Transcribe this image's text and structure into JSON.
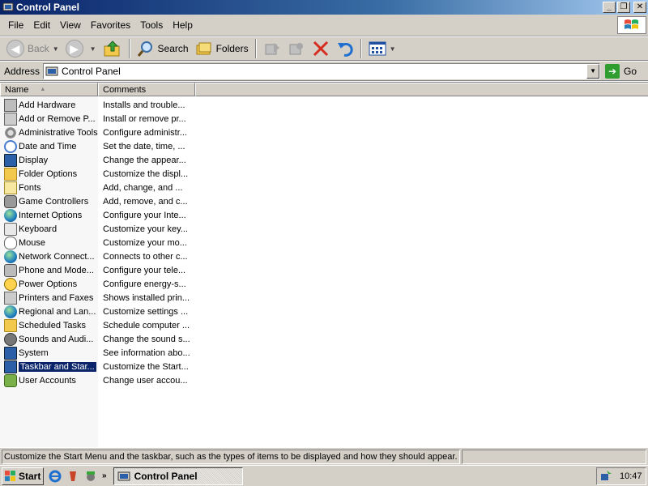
{
  "window": {
    "title": "Control Panel",
    "minimize": "_",
    "restore": "❐",
    "close": "✕"
  },
  "menu": [
    "File",
    "Edit",
    "View",
    "Favorites",
    "Tools",
    "Help"
  ],
  "toolbar": {
    "back": "Back",
    "search": "Search",
    "folders": "Folders"
  },
  "address": {
    "label": "Address",
    "value": "Control Panel",
    "go": "Go"
  },
  "columns": {
    "name": "Name",
    "comments": "Comments"
  },
  "items": [
    {
      "name": "Add Hardware",
      "comment": "Installs and trouble...",
      "icon": "hardware-icon"
    },
    {
      "name": "Add or Remove P...",
      "comment": "Install or remove pr...",
      "icon": "add-remove-programs-icon"
    },
    {
      "name": "Administrative Tools",
      "comment": "Configure administr...",
      "icon": "admin-tools-icon"
    },
    {
      "name": "Date and Time",
      "comment": "Set the date, time, ...",
      "icon": "clock-icon"
    },
    {
      "name": "Display",
      "comment": "Change the appear...",
      "icon": "display-icon"
    },
    {
      "name": "Folder Options",
      "comment": "Customize the displ...",
      "icon": "folder-options-icon"
    },
    {
      "name": "Fonts",
      "comment": "Add, change, and ...",
      "icon": "fonts-icon"
    },
    {
      "name": "Game Controllers",
      "comment": "Add, remove, and c...",
      "icon": "joystick-icon"
    },
    {
      "name": "Internet Options",
      "comment": "Configure your Inte...",
      "icon": "globe-icon"
    },
    {
      "name": "Keyboard",
      "comment": "Customize your key...",
      "icon": "keyboard-icon"
    },
    {
      "name": "Mouse",
      "comment": "Customize your mo...",
      "icon": "mouse-icon"
    },
    {
      "name": "Network Connect...",
      "comment": "Connects to other c...",
      "icon": "network-icon"
    },
    {
      "name": "Phone and Mode...",
      "comment": "Configure your tele...",
      "icon": "phone-icon"
    },
    {
      "name": "Power Options",
      "comment": "Configure energy-s...",
      "icon": "power-icon"
    },
    {
      "name": "Printers and Faxes",
      "comment": "Shows installed prin...",
      "icon": "printer-icon"
    },
    {
      "name": "Regional and Lan...",
      "comment": "Customize settings ...",
      "icon": "regional-globe-icon"
    },
    {
      "name": "Scheduled Tasks",
      "comment": "Schedule computer ...",
      "icon": "scheduled-tasks-icon"
    },
    {
      "name": "Sounds and Audi...",
      "comment": "Change the sound s...",
      "icon": "speaker-icon"
    },
    {
      "name": "System",
      "comment": "See information abo...",
      "icon": "system-icon"
    },
    {
      "name": "Taskbar and Star...",
      "comment": "Customize the Start...",
      "icon": "taskbar-icon",
      "selected": true
    },
    {
      "name": "User Accounts",
      "comment": "Change user accou...",
      "icon": "user-accounts-icon"
    }
  ],
  "status": {
    "text": "Customize the Start Menu and the taskbar, such as the types of items to be displayed and how they should appear."
  },
  "taskbar": {
    "start": "Start",
    "quicklaunch_more": "»",
    "task": "Control Panel",
    "clock": "10:47"
  },
  "colors": {
    "titlebar_start": "#0a246a",
    "titlebar_end": "#a6caf0",
    "chrome": "#d4d0c8",
    "selection": "#0a246a"
  }
}
